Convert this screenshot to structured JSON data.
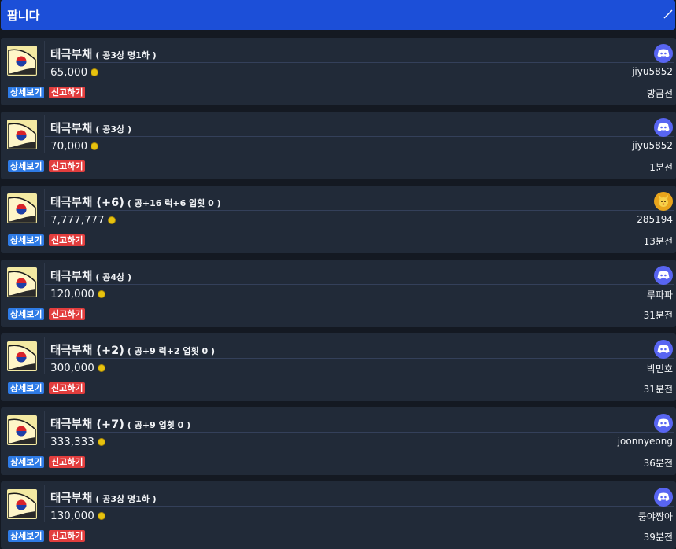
{
  "header": {
    "title": "팝니다",
    "collapse_icon": "chevron-up-icon"
  },
  "colors": {
    "header": "#1c4fd8",
    "card": "#212a38",
    "detail_button": "#2e7be6",
    "report_button": "#e23d3d",
    "discord": "#5865f2",
    "coin": "#e7c20e"
  },
  "buttons": {
    "detail": "상세보기",
    "report": "신고하기"
  },
  "listings": [
    {
      "name": "태극부채",
      "options": "( 공3상 명1하 )",
      "price": "65,000",
      "seller": "jiyu5852",
      "time": "방금전",
      "avatar": "discord-icon"
    },
    {
      "name": "태극부채",
      "options": "( 공3상 )",
      "price": "70,000",
      "seller": "jiyu5852",
      "time": "1분전",
      "avatar": "discord-icon"
    },
    {
      "name": "태극부채 (+6)",
      "options": "( 공+16 럭+6 업횟 0 )",
      "price": "7,777,777",
      "seller": "285194",
      "time": "13분전",
      "avatar": "pet-avatar-icon"
    },
    {
      "name": "태극부채",
      "options": "( 공4상 )",
      "price": "120,000",
      "seller": "루파파",
      "time": "31분전",
      "avatar": "discord-icon"
    },
    {
      "name": "태극부채 (+2)",
      "options": "( 공+9 럭+2 업횟 0 )",
      "price": "300,000",
      "seller": "박민호",
      "time": "31분전",
      "avatar": "discord-icon"
    },
    {
      "name": "태극부채 (+7)",
      "options": "( 공+9 업횟 0 )",
      "price": "333,333",
      "seller": "joonnyeong",
      "time": "36분전",
      "avatar": "discord-icon"
    },
    {
      "name": "태극부채",
      "options": "( 공3상 명1하 )",
      "price": "130,000",
      "seller": "쿵야짱아",
      "time": "39분전",
      "avatar": "discord-icon"
    }
  ]
}
